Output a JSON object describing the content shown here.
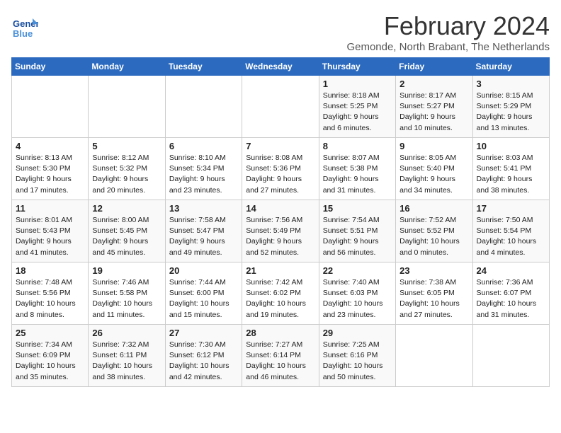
{
  "logo": {
    "text_general": "General",
    "text_blue": "Blue"
  },
  "header": {
    "month": "February 2024",
    "location": "Gemonde, North Brabant, The Netherlands"
  },
  "weekdays": [
    "Sunday",
    "Monday",
    "Tuesday",
    "Wednesday",
    "Thursday",
    "Friday",
    "Saturday"
  ],
  "weeks": [
    [
      {
        "day": "",
        "content": ""
      },
      {
        "day": "",
        "content": ""
      },
      {
        "day": "",
        "content": ""
      },
      {
        "day": "",
        "content": ""
      },
      {
        "day": "1",
        "content": "Sunrise: 8:18 AM\nSunset: 5:25 PM\nDaylight: 9 hours\nand 6 minutes."
      },
      {
        "day": "2",
        "content": "Sunrise: 8:17 AM\nSunset: 5:27 PM\nDaylight: 9 hours\nand 10 minutes."
      },
      {
        "day": "3",
        "content": "Sunrise: 8:15 AM\nSunset: 5:29 PM\nDaylight: 9 hours\nand 13 minutes."
      }
    ],
    [
      {
        "day": "4",
        "content": "Sunrise: 8:13 AM\nSunset: 5:30 PM\nDaylight: 9 hours\nand 17 minutes."
      },
      {
        "day": "5",
        "content": "Sunrise: 8:12 AM\nSunset: 5:32 PM\nDaylight: 9 hours\nand 20 minutes."
      },
      {
        "day": "6",
        "content": "Sunrise: 8:10 AM\nSunset: 5:34 PM\nDaylight: 9 hours\nand 23 minutes."
      },
      {
        "day": "7",
        "content": "Sunrise: 8:08 AM\nSunset: 5:36 PM\nDaylight: 9 hours\nand 27 minutes."
      },
      {
        "day": "8",
        "content": "Sunrise: 8:07 AM\nSunset: 5:38 PM\nDaylight: 9 hours\nand 31 minutes."
      },
      {
        "day": "9",
        "content": "Sunrise: 8:05 AM\nSunset: 5:40 PM\nDaylight: 9 hours\nand 34 minutes."
      },
      {
        "day": "10",
        "content": "Sunrise: 8:03 AM\nSunset: 5:41 PM\nDaylight: 9 hours\nand 38 minutes."
      }
    ],
    [
      {
        "day": "11",
        "content": "Sunrise: 8:01 AM\nSunset: 5:43 PM\nDaylight: 9 hours\nand 41 minutes."
      },
      {
        "day": "12",
        "content": "Sunrise: 8:00 AM\nSunset: 5:45 PM\nDaylight: 9 hours\nand 45 minutes."
      },
      {
        "day": "13",
        "content": "Sunrise: 7:58 AM\nSunset: 5:47 PM\nDaylight: 9 hours\nand 49 minutes."
      },
      {
        "day": "14",
        "content": "Sunrise: 7:56 AM\nSunset: 5:49 PM\nDaylight: 9 hours\nand 52 minutes."
      },
      {
        "day": "15",
        "content": "Sunrise: 7:54 AM\nSunset: 5:51 PM\nDaylight: 9 hours\nand 56 minutes."
      },
      {
        "day": "16",
        "content": "Sunrise: 7:52 AM\nSunset: 5:52 PM\nDaylight: 10 hours\nand 0 minutes."
      },
      {
        "day": "17",
        "content": "Sunrise: 7:50 AM\nSunset: 5:54 PM\nDaylight: 10 hours\nand 4 minutes."
      }
    ],
    [
      {
        "day": "18",
        "content": "Sunrise: 7:48 AM\nSunset: 5:56 PM\nDaylight: 10 hours\nand 8 minutes."
      },
      {
        "day": "19",
        "content": "Sunrise: 7:46 AM\nSunset: 5:58 PM\nDaylight: 10 hours\nand 11 minutes."
      },
      {
        "day": "20",
        "content": "Sunrise: 7:44 AM\nSunset: 6:00 PM\nDaylight: 10 hours\nand 15 minutes."
      },
      {
        "day": "21",
        "content": "Sunrise: 7:42 AM\nSunset: 6:02 PM\nDaylight: 10 hours\nand 19 minutes."
      },
      {
        "day": "22",
        "content": "Sunrise: 7:40 AM\nSunset: 6:03 PM\nDaylight: 10 hours\nand 23 minutes."
      },
      {
        "day": "23",
        "content": "Sunrise: 7:38 AM\nSunset: 6:05 PM\nDaylight: 10 hours\nand 27 minutes."
      },
      {
        "day": "24",
        "content": "Sunrise: 7:36 AM\nSunset: 6:07 PM\nDaylight: 10 hours\nand 31 minutes."
      }
    ],
    [
      {
        "day": "25",
        "content": "Sunrise: 7:34 AM\nSunset: 6:09 PM\nDaylight: 10 hours\nand 35 minutes."
      },
      {
        "day": "26",
        "content": "Sunrise: 7:32 AM\nSunset: 6:11 PM\nDaylight: 10 hours\nand 38 minutes."
      },
      {
        "day": "27",
        "content": "Sunrise: 7:30 AM\nSunset: 6:12 PM\nDaylight: 10 hours\nand 42 minutes."
      },
      {
        "day": "28",
        "content": "Sunrise: 7:27 AM\nSunset: 6:14 PM\nDaylight: 10 hours\nand 46 minutes."
      },
      {
        "day": "29",
        "content": "Sunrise: 7:25 AM\nSunset: 6:16 PM\nDaylight: 10 hours\nand 50 minutes."
      },
      {
        "day": "",
        "content": ""
      },
      {
        "day": "",
        "content": ""
      }
    ]
  ]
}
